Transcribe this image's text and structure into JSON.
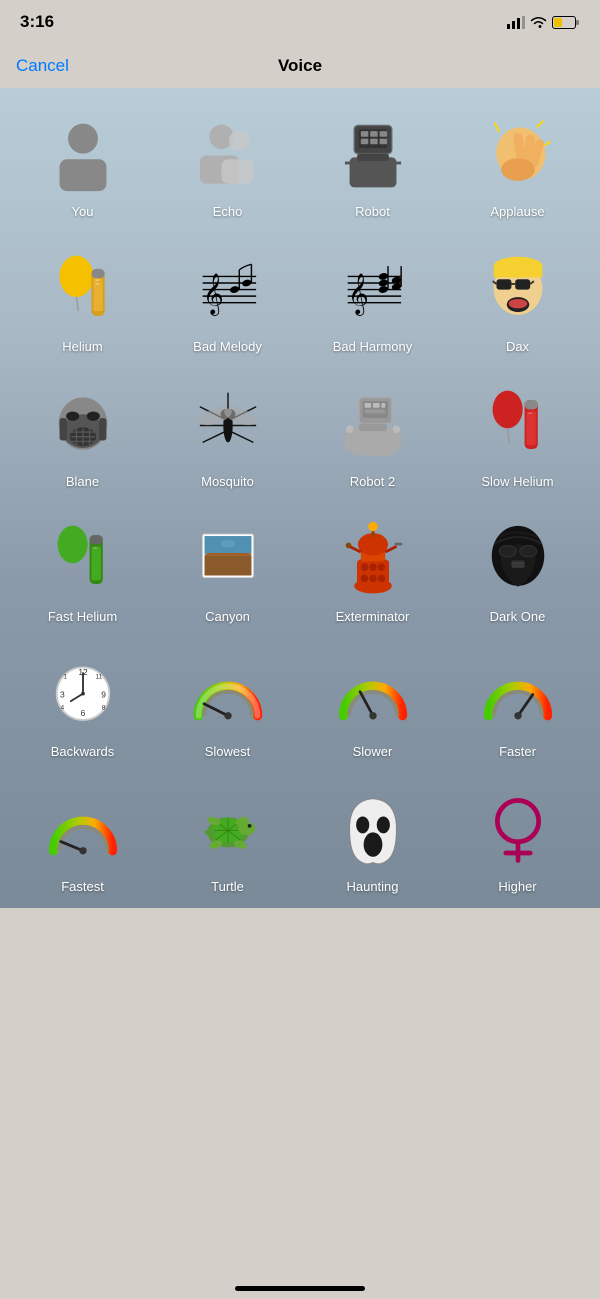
{
  "statusBar": {
    "time": "3:16",
    "signalBars": [
      3,
      4,
      5,
      6
    ],
    "battery": "low"
  },
  "navBar": {
    "cancelLabel": "Cancel",
    "titleLabel": "Voice"
  },
  "voiceItems": [
    {
      "id": "you",
      "label": "You",
      "icon": "person"
    },
    {
      "id": "echo",
      "label": "Echo",
      "icon": "echo"
    },
    {
      "id": "robot",
      "label": "Robot",
      "icon": "robot"
    },
    {
      "id": "applause",
      "label": "Applause",
      "icon": "applause"
    },
    {
      "id": "helium",
      "label": "Helium",
      "icon": "helium"
    },
    {
      "id": "bad-melody",
      "label": "Bad Melody",
      "icon": "music-notes"
    },
    {
      "id": "bad-harmony",
      "label": "Bad Harmony",
      "icon": "music-harmony"
    },
    {
      "id": "dax",
      "label": "Dax",
      "icon": "dax"
    },
    {
      "id": "blane",
      "label": "Blane",
      "icon": "blane"
    },
    {
      "id": "mosquito",
      "label": "Mosquito",
      "icon": "mosquito"
    },
    {
      "id": "robot2",
      "label": "Robot 2",
      "icon": "robot2"
    },
    {
      "id": "slow-helium",
      "label": "Slow Helium",
      "icon": "slow-helium"
    },
    {
      "id": "fast-helium",
      "label": "Fast Helium",
      "icon": "fast-helium"
    },
    {
      "id": "canyon",
      "label": "Canyon",
      "icon": "canyon"
    },
    {
      "id": "exterminator",
      "label": "Exterminator",
      "icon": "exterminator"
    },
    {
      "id": "dark-one",
      "label": "Dark One",
      "icon": "dark-one"
    },
    {
      "id": "backwards",
      "label": "Backwards",
      "icon": "backwards"
    },
    {
      "id": "slowest",
      "label": "Slowest",
      "icon": "gauge-slowest"
    },
    {
      "id": "slower",
      "label": "Slower",
      "icon": "gauge-slower"
    },
    {
      "id": "faster",
      "label": "Faster",
      "icon": "gauge-faster"
    },
    {
      "id": "fastest",
      "label": "Fastest",
      "icon": "gauge-fastest"
    },
    {
      "id": "turtle",
      "label": "Turtle",
      "icon": "turtle"
    },
    {
      "id": "haunting",
      "label": "Haunting",
      "icon": "haunting"
    },
    {
      "id": "higher",
      "label": "Higher",
      "icon": "higher"
    }
  ]
}
